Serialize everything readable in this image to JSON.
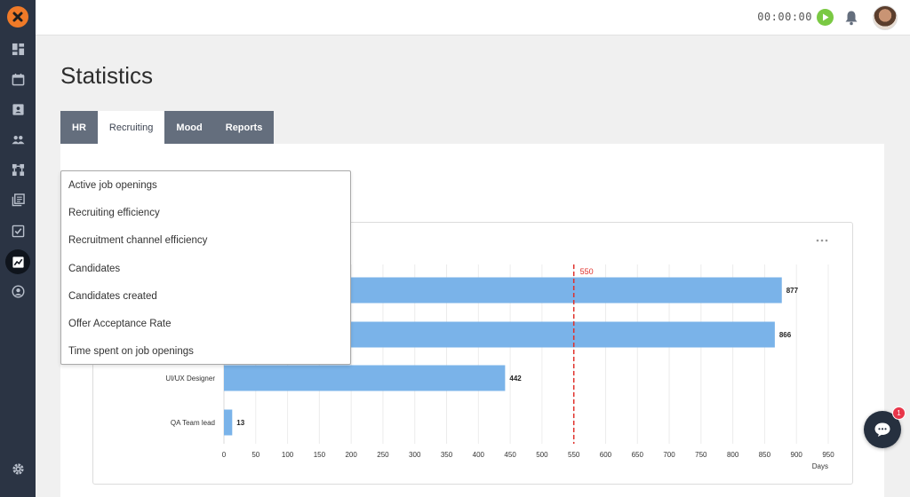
{
  "header": {
    "timer": "00:00:00"
  },
  "sidebar": {
    "items": [
      {
        "icon": "dashboard-icon"
      },
      {
        "icon": "calendar-icon"
      },
      {
        "icon": "contact-card-icon"
      },
      {
        "icon": "people-icon"
      },
      {
        "icon": "org-chart-icon"
      },
      {
        "icon": "documents-icon"
      },
      {
        "icon": "checklist-icon"
      },
      {
        "icon": "statistics-icon",
        "active": true
      },
      {
        "icon": "profile-icon"
      },
      {
        "icon": "settings-icon"
      }
    ]
  },
  "page": {
    "title": "Statistics"
  },
  "tabs": [
    {
      "label": "HR",
      "active": false
    },
    {
      "label": "Recruiting",
      "active": true
    },
    {
      "label": "Mood",
      "active": false
    },
    {
      "label": "Reports",
      "active": false
    }
  ],
  "dropdown": {
    "items": [
      "Active job openings",
      "Recruiting efficiency",
      "Recruitment channel efficiency",
      "Candidates",
      "Candidates created",
      "Offer Acceptance Rate",
      "Time spent on job openings"
    ]
  },
  "chat": {
    "badge_count": "1"
  },
  "chart_data": {
    "type": "bar",
    "orientation": "horizontal",
    "categories": [
      "",
      "",
      "UI/UX Designer",
      "QA Team lead"
    ],
    "values": [
      877,
      866,
      442,
      13
    ],
    "value_labels": [
      "877",
      "866",
      "442",
      "13"
    ],
    "xlabel": "Days",
    "xlim": [
      0,
      950
    ],
    "xticks": [
      0,
      50,
      100,
      150,
      200,
      250,
      300,
      350,
      400,
      450,
      500,
      550,
      600,
      650,
      700,
      750,
      800,
      850,
      900,
      950
    ],
    "reference_line": {
      "value": 550,
      "label": "550",
      "color": "#e0302a"
    },
    "bar_color": "#7ab3e9",
    "grid": true
  },
  "colors": {
    "sidebar_bg": "#2b3444",
    "logo_orange": "#f07a28",
    "tab_bg": "#646e7d",
    "play_green": "#7ac943",
    "badge_red": "#e8364a"
  }
}
